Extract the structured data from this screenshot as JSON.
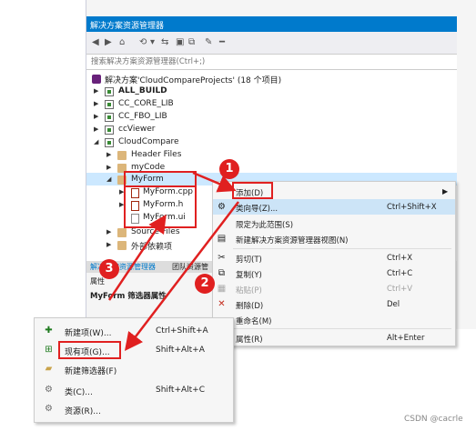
{
  "window": {
    "title": "解决方案资源管理器"
  },
  "search": {
    "placeholder": "搜索解决方案资源管理器(Ctrl+;)"
  },
  "tree": {
    "solution": "解决方案'CloudCompareProjects' (18 个项目)",
    "items": [
      {
        "label": "ALL_BUILD",
        "bold": true
      },
      {
        "label": "CC_CORE_LIB"
      },
      {
        "label": "CC_FBO_LIB"
      },
      {
        "label": "ccViewer"
      },
      {
        "label": "CloudCompare"
      },
      {
        "label": "Header Files"
      },
      {
        "label": "myCode"
      },
      {
        "label": "MyForm"
      },
      {
        "label": "MyForm.cpp"
      },
      {
        "label": "MyForm.h"
      },
      {
        "label": "MyForm.ui"
      },
      {
        "label": "Source Files"
      },
      {
        "label": "外部依赖项"
      }
    ]
  },
  "bottom_tabs": [
    "解决方案资源管理器",
    "团队资源管"
  ],
  "properties": {
    "title": "属性",
    "subject": "MyForm 筛选器属性"
  },
  "context_menu": [
    {
      "label": "添加(D)",
      "shortcut": "",
      "submenu": true
    },
    {
      "label": "类向导(Z)...",
      "shortcut": "Ctrl+Shift+X"
    },
    {
      "label": "限定为此范围(S)",
      "shortcut": ""
    },
    {
      "label": "新建解决方案资源管理器视图(N)",
      "shortcut": ""
    },
    {
      "label": "剪切(T)",
      "shortcut": "Ctrl+X"
    },
    {
      "label": "复制(Y)",
      "shortcut": "Ctrl+C"
    },
    {
      "label": "粘贴(P)",
      "shortcut": "Ctrl+V",
      "disabled": true
    },
    {
      "label": "删除(D)",
      "shortcut": "Del"
    },
    {
      "label": "重命名(M)",
      "shortcut": ""
    },
    {
      "label": "属性(R)",
      "shortcut": "Alt+Enter"
    }
  ],
  "add_submenu": [
    {
      "label": "新建项(W)...",
      "shortcut": "Ctrl+Shift+A"
    },
    {
      "label": "现有项(G)...",
      "shortcut": "Shift+Alt+A"
    },
    {
      "label": "新建筛选器(F)",
      "shortcut": ""
    },
    {
      "label": "类(C)...",
      "shortcut": "Shift+Alt+C"
    },
    {
      "label": "资源(R)...",
      "shortcut": ""
    }
  ],
  "annotations": {
    "step1": "1",
    "step2": "2",
    "step3": "3"
  },
  "watermark": "CSDN @cacrle",
  "colors": {
    "accent": "#007acc",
    "annotation": "#e02020",
    "selection": "#cce8ff"
  }
}
